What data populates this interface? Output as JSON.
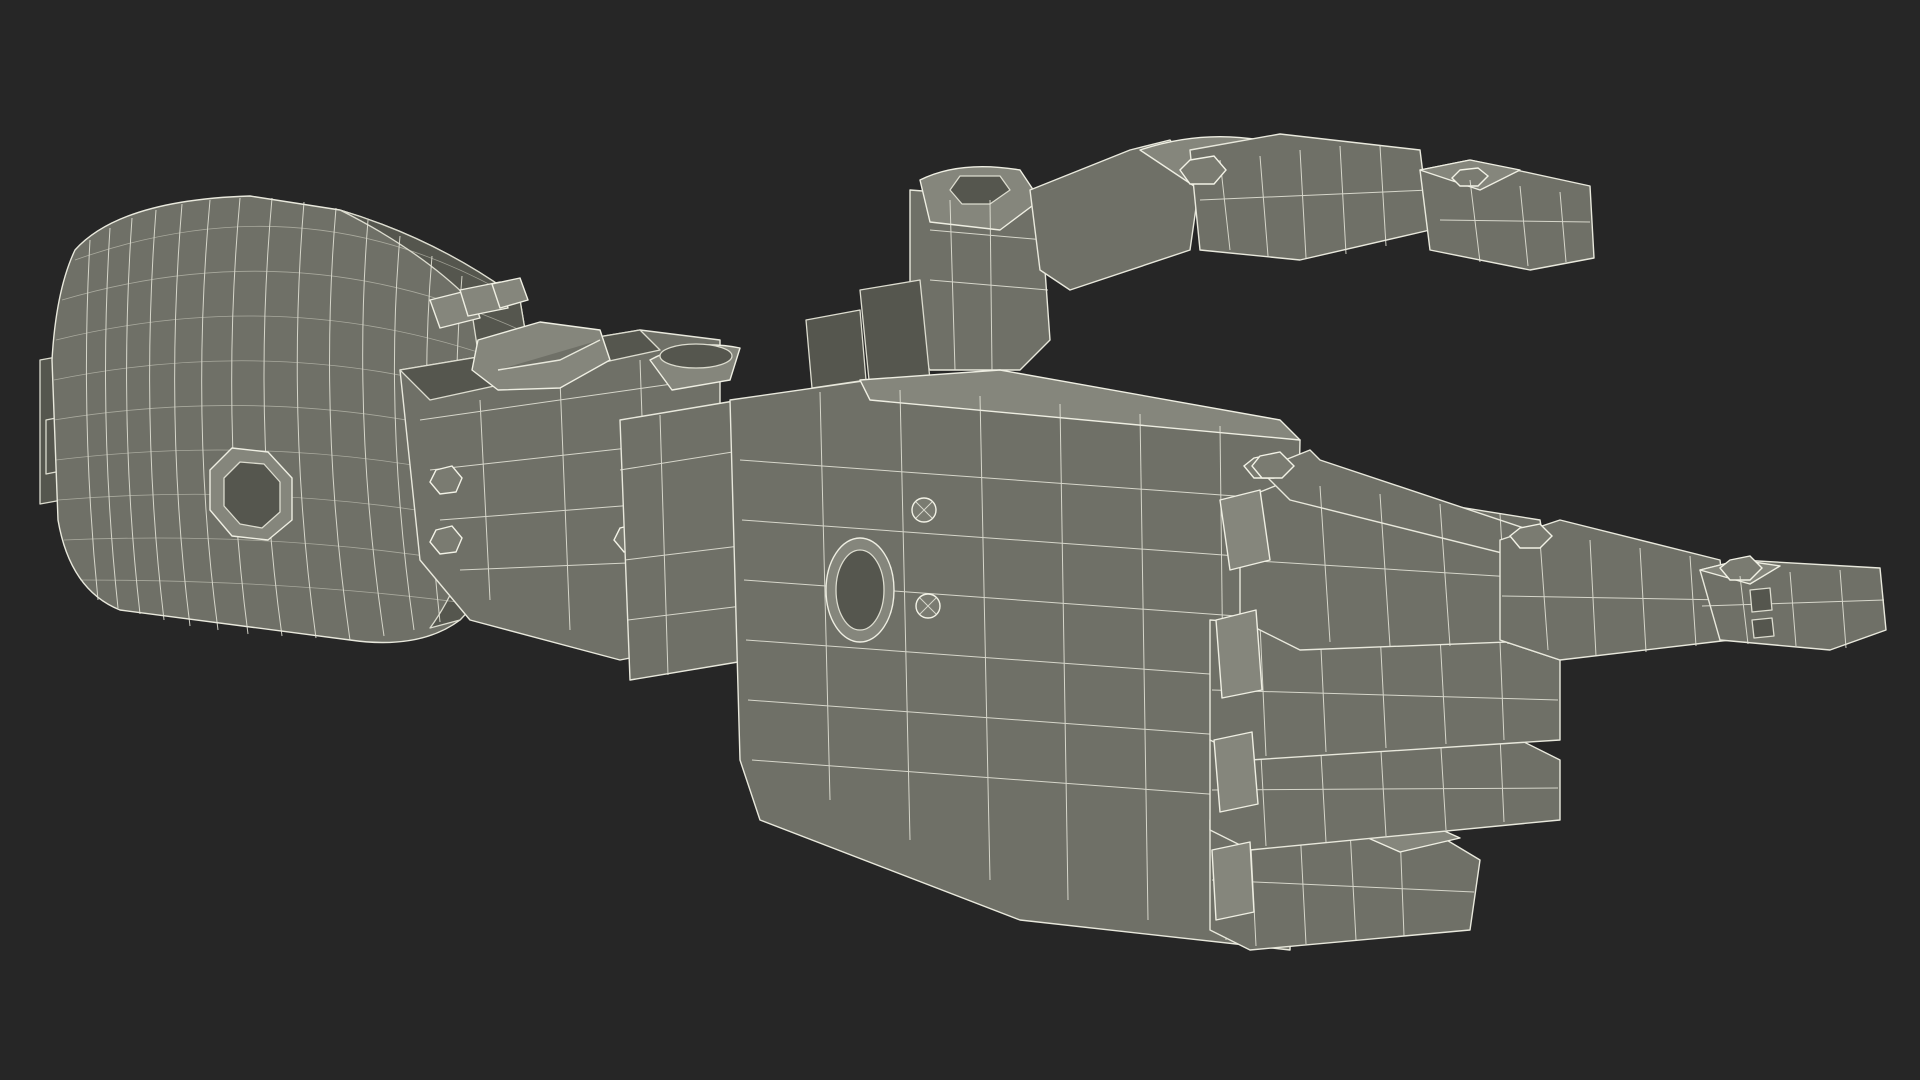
{
  "scene": {
    "background_color": "#262626",
    "mesh_color": "#6f7067",
    "wireframe_color": "#e8e8dc",
    "subject": "robotic-hand-wireframe-model",
    "pose": "pointing-index-finger"
  }
}
